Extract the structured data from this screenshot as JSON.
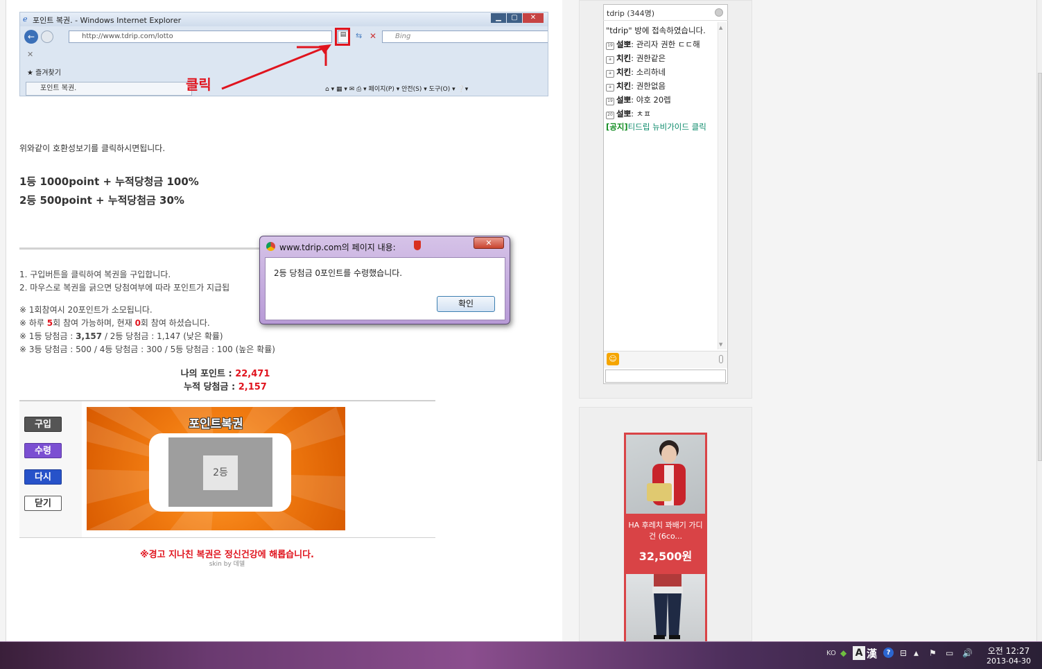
{
  "ie_screenshot": {
    "window_title": "포인트 복권. - Windows Internet Explorer",
    "address_url": "http://www.tdrip.com/lotto",
    "search_placeholder": "Bing",
    "favorites_label": "즐겨찾기",
    "tab_label": "포인트 복권.",
    "toolbar_menu": "페이지(P) ▾   안전(S) ▾   도구(O) ▾",
    "compat_icon": "compat-view-icon"
  },
  "annotation": {
    "click_label": "클릭"
  },
  "content": {
    "compat_instruction": "위와같이 호환성보기를 클릭하시면됩니다.",
    "prize1": "1등  1000point + 누적당청금 100%",
    "prize2": "2등  500point + 누적당첨금 30%",
    "instruction1": "1. 구입버튼을 클릭하여 복권을 구입합니다.",
    "instruction2": "2. 마우스로 복권을 긁으면 당첨여부에 따라 포인트가 지급됩",
    "note1": "※ 1회참여시 20포인트가 소모됩니다.",
    "note2_pre": "※ 하루 ",
    "note2_max": "5",
    "note2_mid": "회 참여 가능하며, 현재 ",
    "note2_count": "0",
    "note2_post": "회 참여 하셨습니다.",
    "note3_pre": "※ 1등 당첨금 : ",
    "note3_first": "3,157",
    "note3_post": " / 2등 당첨금 : 1,147 (낮은 확률)",
    "note4": "※ 3등 당첨금 : 500 / 4등 당첨금 : 300 / 5등 당첨금 : 100 (높은 확률)",
    "my_point_label": "나의 포인트 : ",
    "my_point_value": "22,471",
    "jackpot_label": "누적 당첨금 : ",
    "jackpot_value": "2,157"
  },
  "lotto": {
    "buttons": {
      "buy": "구입",
      "redeem": "수령",
      "again": "다시",
      "close": "닫기"
    },
    "title": "포인트복권",
    "result": "2등",
    "warning": "※경고 지나친 복권은 정신건강에 해롭습니다.",
    "skin_credit": "skin by 데델"
  },
  "dialog": {
    "title": "www.tdrip.com의 페이지 내용:",
    "close": "✕",
    "message": "2등 당첨금 0포인트를 수령했습니다.",
    "ok": "확인"
  },
  "chat": {
    "title": "tdrip (344명)",
    "welcome": "\"tdrip\" 방에 접속하였습니다.",
    "messages": [
      {
        "level": "19",
        "nick": "설뽀",
        "text": ": 관리자 권한 ㄷㄷ해"
      },
      {
        "level": "a",
        "nick": "치킨",
        "text": ": 권한같은"
      },
      {
        "level": "a",
        "nick": "치킨",
        "text": ": 소리하네"
      },
      {
        "level": "a",
        "nick": "치킨",
        "text": ": 권한없음"
      },
      {
        "level": "19",
        "nick": "설뽀",
        "text": ": 야호 20렙"
      },
      {
        "level": "20",
        "nick": "설뽀",
        "text": ": ㅊㅍ"
      }
    ],
    "notice_tag": "[공지]",
    "notice_text": "티드립 뉴비가이드 클릭"
  },
  "ad": {
    "product_name": "HA 후레치 꽈배기 가디건 (6co...",
    "price": "32,500원"
  },
  "taskbar": {
    "lang": "KO",
    "ime_a": "A",
    "ime_han": "漢",
    "time": "오전 12:27",
    "date": "2013-04-30"
  }
}
